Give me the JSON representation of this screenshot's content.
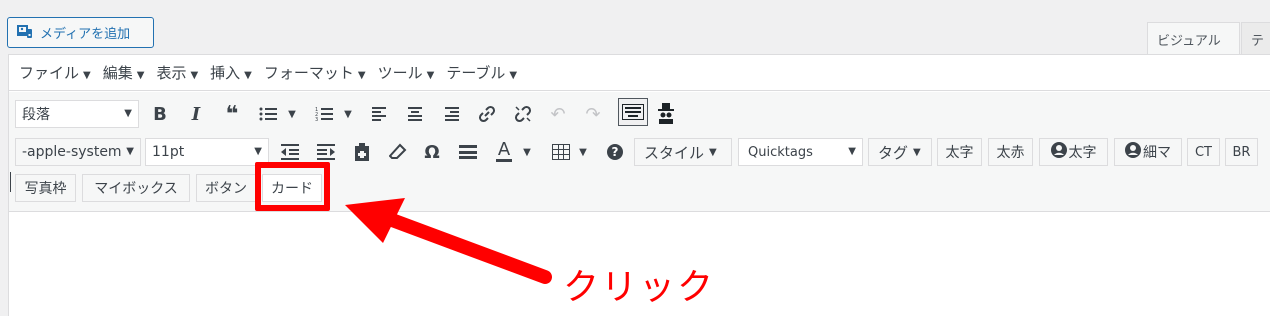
{
  "media_button": {
    "label": "メディアを追加"
  },
  "tabs": {
    "visual": "ビジュアル",
    "text": "テ"
  },
  "menubar": [
    {
      "label": "ファイル"
    },
    {
      "label": "編集"
    },
    {
      "label": "表示"
    },
    {
      "label": "挿入"
    },
    {
      "label": "フォーマット"
    },
    {
      "label": "ツール"
    },
    {
      "label": "テーブル"
    }
  ],
  "toolbar": {
    "paragraph_select": "段落",
    "bold": "B",
    "italic": "I",
    "quote": "❝",
    "omega": "Ω",
    "font_family": "-apple-system",
    "font_size": "11pt",
    "text_color": "A",
    "help": "?",
    "style_button": "スタイル",
    "quicktags_select": "Quicktags",
    "tag_button": "タグ",
    "btn_futoji": "太字",
    "btn_futoaka": "太赤",
    "btn_avatar_futoji": "太字",
    "btn_avatar_hosoma": "細マ",
    "btn_ct": "CT",
    "btn_br": "BR",
    "btn_shashinwaku": "写真枠",
    "btn_mybox": "マイボックス",
    "btn_button": "ボタン",
    "btn_card": "カード"
  },
  "annotation": {
    "text": "クリック",
    "color": "#ff0000"
  },
  "colors": {
    "accent": "#2271b1",
    "highlight": "#ff0000"
  }
}
